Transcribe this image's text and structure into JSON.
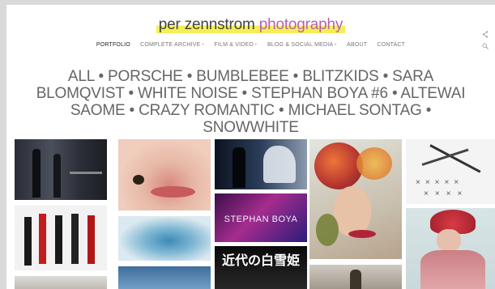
{
  "site": {
    "title_part1": "per zennstrom",
    "title_part2": "photography"
  },
  "nav": {
    "items": [
      {
        "label": "PORTFOLIO",
        "active": true,
        "has_submenu": false
      },
      {
        "label": "COMPLETE ARCHIVE",
        "active": false,
        "has_submenu": true
      },
      {
        "label": "FILM & VIDEO",
        "active": false,
        "has_submenu": true
      },
      {
        "label": "BLOG & SOCIAL MEDIA",
        "active": false,
        "has_submenu": true
      },
      {
        "label": "ABOUT",
        "active": false,
        "has_submenu": false
      },
      {
        "label": "CONTACT",
        "active": false,
        "has_submenu": false
      }
    ],
    "submenu_marker": "+"
  },
  "icons": {
    "share": "share-icon",
    "search": "search-icon"
  },
  "categories": [
    "ALL",
    "PORSCHE",
    "BUMBLEBEE",
    "BLITZKIDS",
    "SARA BLOMQVIST",
    "WHITE NOISE",
    "STEPHAN BOYA #6",
    "ALTEWAI SAOME",
    "CRAZY ROMANTIC",
    "MICHAEL SONTAG",
    "SNOWWHITE"
  ],
  "category_separator": " • ",
  "thumbnails": {
    "stephan_boya_text": "STEPHAN BOYA",
    "snowwhite_text": "近代の白雪姫"
  }
}
